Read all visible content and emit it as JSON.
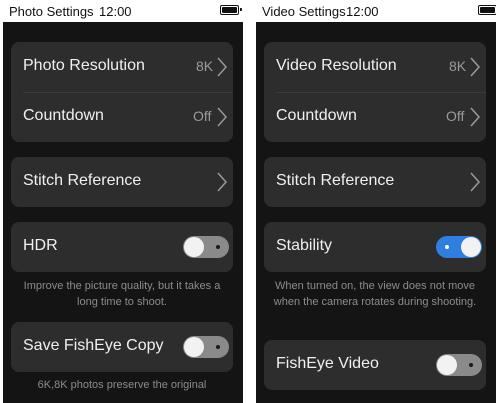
{
  "panels": [
    {
      "status_title": "Photo Settings",
      "status_time": "12:00",
      "group1": {
        "row1": {
          "label": "Photo Resolution",
          "value": "8K"
        },
        "row2": {
          "label": "Countdown",
          "value": "Off"
        }
      },
      "group2": {
        "label": "Stitch Reference"
      },
      "group3": {
        "label": "HDR",
        "toggle_on": false
      },
      "caption1": "Improve the picture quality, but it takes a long time to shoot.",
      "group4": {
        "label": "Save FishEye Copy",
        "toggle_on": false
      },
      "caption2": "6K,8K photos preserve the original"
    },
    {
      "status_title": "Video Settings",
      "status_time": "12:00",
      "group1": {
        "row1": {
          "label": "Video Resolution",
          "value": "8K"
        },
        "row2": {
          "label": "Countdown",
          "value": "Off"
        }
      },
      "group2": {
        "label": "Stitch Reference"
      },
      "group3": {
        "label": "Stability",
        "toggle_on": true
      },
      "caption1": "When turned on, the view does not move when the camera rotates during shooting.",
      "group4": {
        "label": "FishEye Video",
        "toggle_on": false
      }
    }
  ],
  "colors": {
    "background": "#141414",
    "card": "#2d2d2d",
    "toggle_on": "#2f7fe0",
    "toggle_off": "#8a8a8a",
    "text": "#f0f0f0",
    "muted": "#8c8c8c"
  },
  "icons": {
    "chevron": "chevron-right-icon",
    "battery": "battery-icon"
  }
}
